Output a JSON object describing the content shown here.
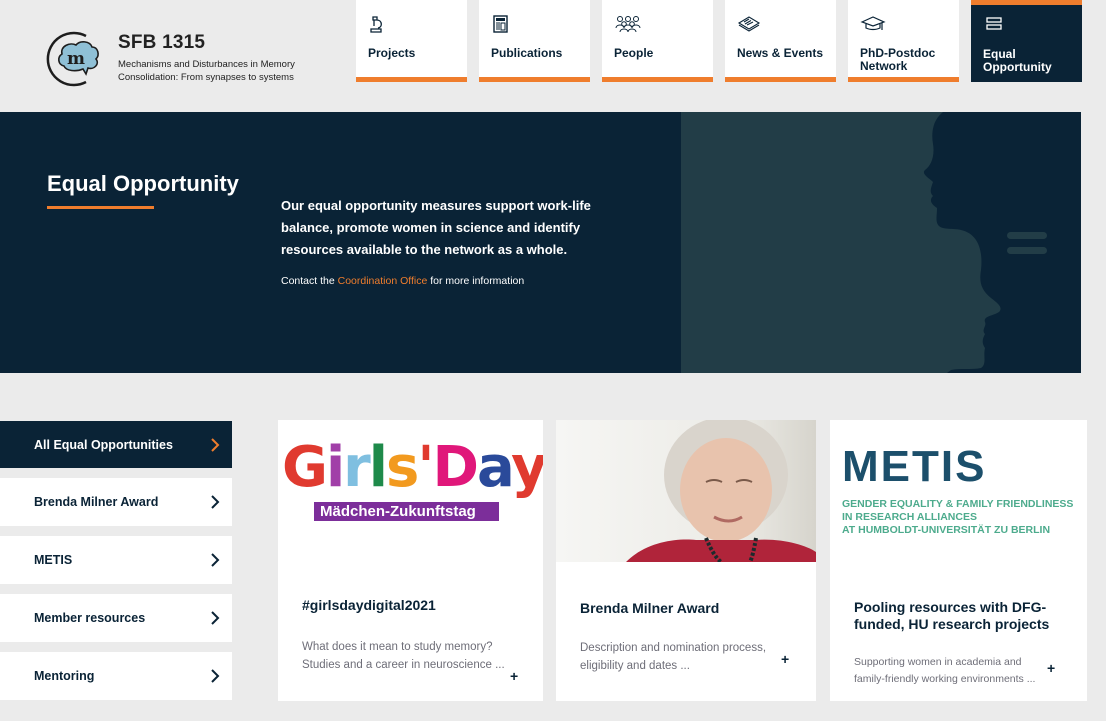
{
  "header": {
    "logo": {
      "title": "SFB 1315",
      "subtitle_line1": "Mechanisms and Disturbances in Memory",
      "subtitle_line2": "Consolidation: From synapses to systems"
    },
    "nav": [
      {
        "label": "Projects",
        "icon": "microscope-icon"
      },
      {
        "label": "Publications",
        "icon": "newspaper-icon"
      },
      {
        "label": "People",
        "icon": "people-group-icon"
      },
      {
        "label": "News & Events",
        "icon": "news-stack-icon"
      },
      {
        "label": "PhD-Postdoc Network",
        "icon": "graduation-cap-icon"
      },
      {
        "label": "Equal Opportunity",
        "icon": "equals-icon",
        "active": true
      }
    ]
  },
  "hero": {
    "title": "Equal Opportunity",
    "description": "Our equal opportunity measures support work-life balance, promote women in science and identify resources available to the network as a whole.",
    "contact_prefix": "Contact the",
    "contact_link": "Coordination Office",
    "contact_suffix": "for more information"
  },
  "sidebar": {
    "items": [
      {
        "label": "All Equal Opportunities",
        "active": true
      },
      {
        "label": "Brenda Milner Award"
      },
      {
        "label": "METIS"
      },
      {
        "label": "Member resources"
      },
      {
        "label": "Mentoring"
      }
    ]
  },
  "cards": [
    {
      "image_alt": "Girls'Day Mädchen-Zukunftstag logo",
      "image_banner": "Mädchen-Zukunftstag",
      "title": "#girlsdaydigital2021",
      "description": "What does it mean to study memory? Studies and a career in neuroscience ...",
      "more": "+"
    },
    {
      "image_alt": "Portrait of Brenda Milner",
      "title": "Brenda Milner Award",
      "description": "Description and nomination process, eligibility and dates ...",
      "more": "+"
    },
    {
      "image_alt": "METIS logo",
      "image_word": "METIS",
      "image_sub_line1": "GENDER EQUALITY & FAMILY FRIENDLINESS",
      "image_sub_line2": "IN RESEARCH ALLIANCES",
      "image_sub_line3": "AT HUMBOLDT-UNIVERSITÄT ZU BERLIN",
      "title": "Pooling resources with DFG-funded, HU research projects",
      "description": "Supporting women in academia and family-friendly working environments ...",
      "more": "+"
    }
  ],
  "colors": {
    "navy": "#0a2336",
    "accent_orange": "#ef7d2d",
    "page_bg": "#ebebeb",
    "silhouette": "#223d47"
  }
}
